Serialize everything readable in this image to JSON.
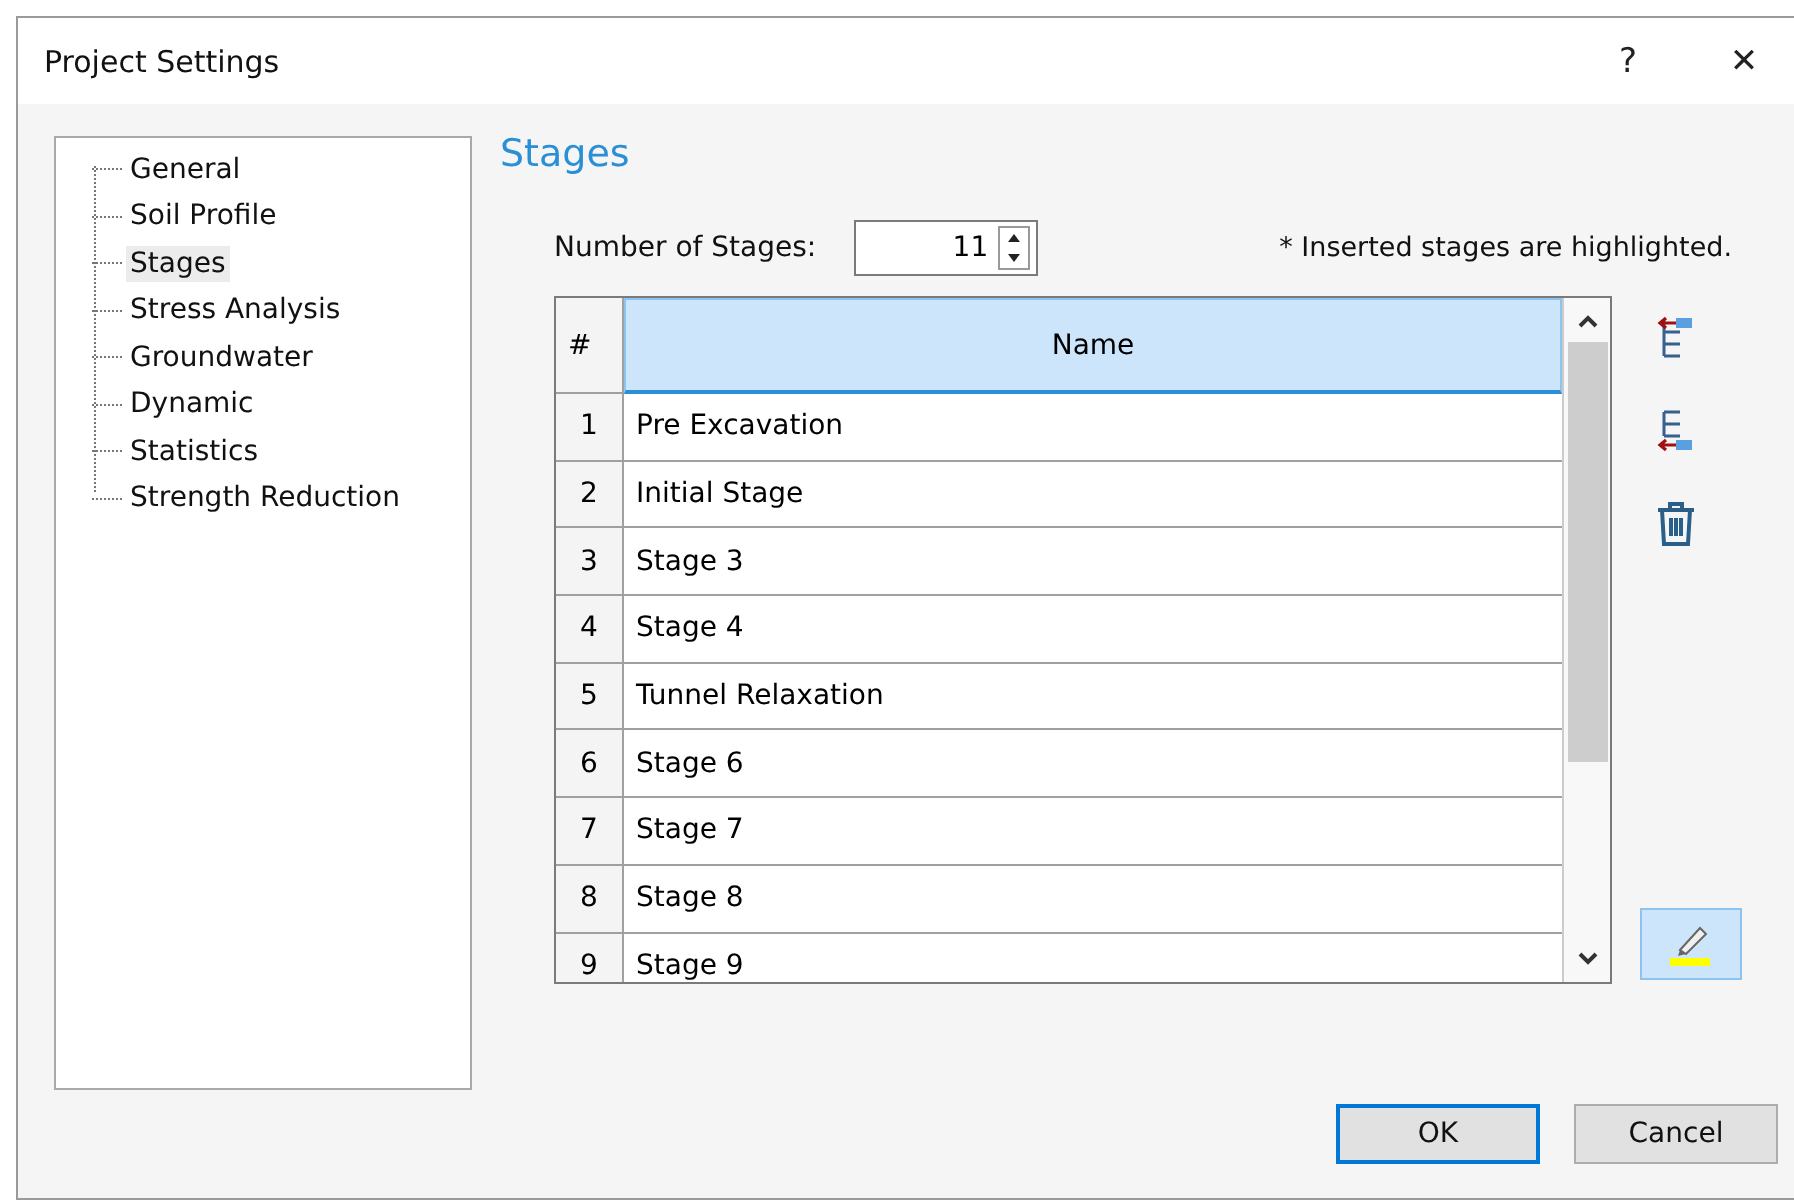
{
  "window": {
    "title": "Project Settings",
    "help": "?",
    "close": "✕"
  },
  "sidebar": {
    "items": [
      {
        "label": "General",
        "selected": false
      },
      {
        "label": "Soil Profile",
        "selected": false
      },
      {
        "label": "Stages",
        "selected": true
      },
      {
        "label": "Stress Analysis",
        "selected": false
      },
      {
        "label": "Groundwater",
        "selected": false
      },
      {
        "label": "Dynamic",
        "selected": false
      },
      {
        "label": "Statistics",
        "selected": false
      },
      {
        "label": "Strength Reduction",
        "selected": false
      }
    ]
  },
  "heading": "Stages",
  "stage_count": {
    "label": "Number of Stages:",
    "value": "11"
  },
  "note": "* Inserted stages are highlighted.",
  "table": {
    "columns": [
      "#",
      "Name"
    ],
    "rows": [
      [
        "1",
        "Pre Excavation"
      ],
      [
        "2",
        "Initial Stage"
      ],
      [
        "3",
        "Stage 3"
      ],
      [
        "4",
        "Stage 4"
      ],
      [
        "5",
        "Tunnel Relaxation"
      ],
      [
        "6",
        "Stage 6"
      ],
      [
        "7",
        "Stage 7"
      ],
      [
        "8",
        "Stage 8"
      ],
      [
        "9",
        "Stage 9"
      ]
    ]
  },
  "highlight_tool": {
    "on": true
  },
  "buttons": [
    "OK",
    "Cancel"
  ]
}
